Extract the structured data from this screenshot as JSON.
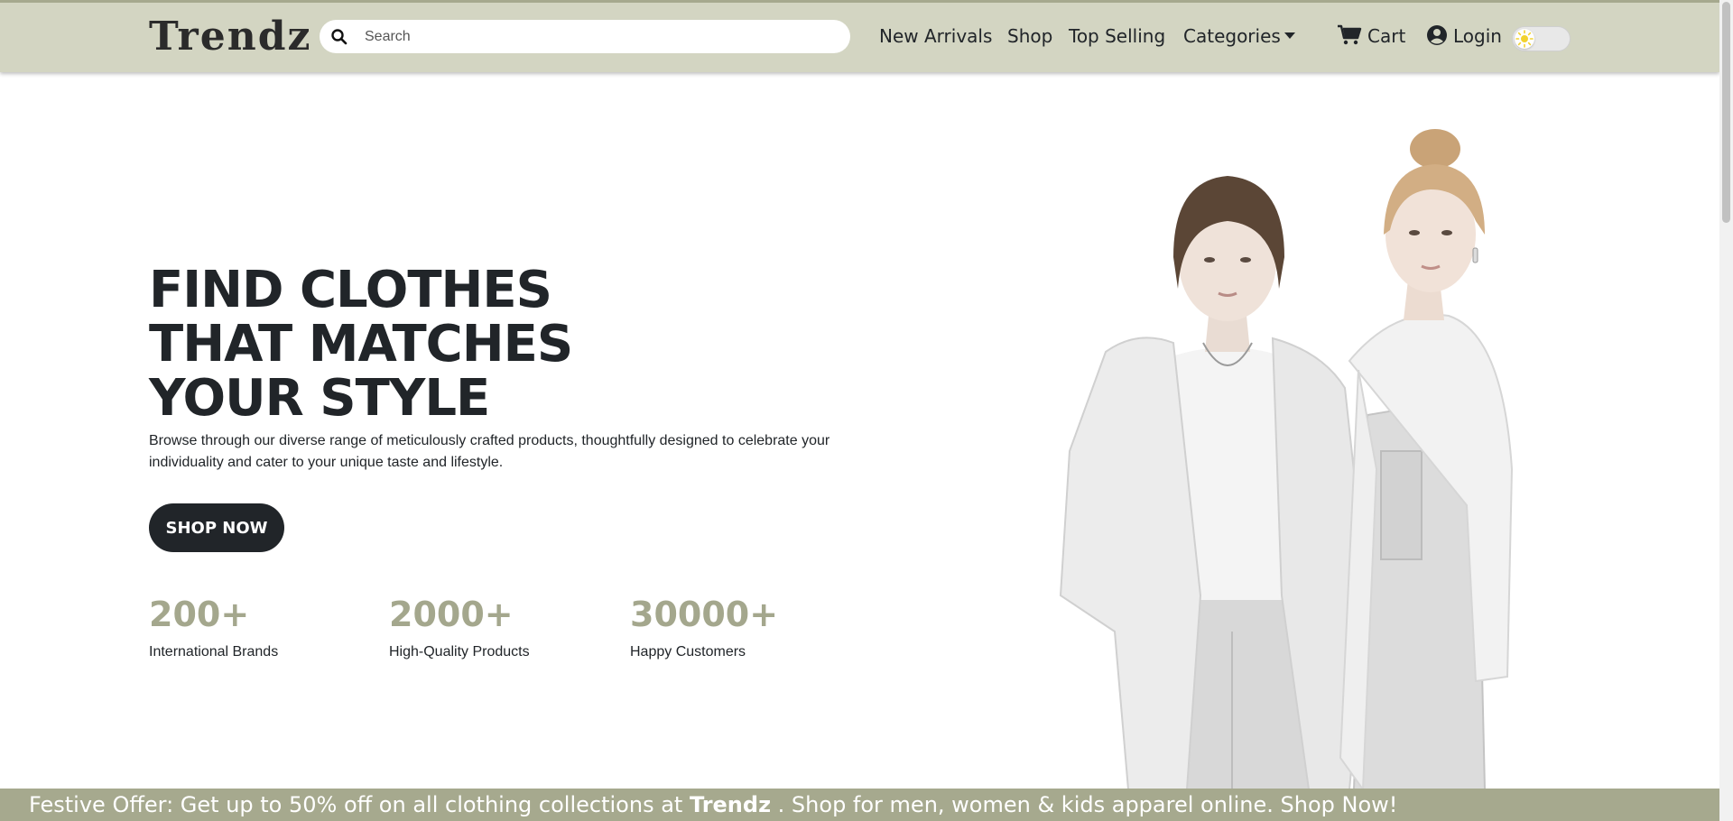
{
  "header": {
    "logo": "Trendz",
    "search_placeholder": "Search",
    "nav": {
      "new_arrivals": "New Arrivals",
      "shop": "Shop",
      "top_selling": "Top Selling",
      "categories": "Categories",
      "cart": "Cart",
      "login": "Login"
    },
    "theme_toggle": {
      "state": "light",
      "icon": "sun-icon"
    }
  },
  "hero": {
    "title_lines": [
      "FIND CLOTHES",
      "THAT MATCHES",
      "YOUR STYLE"
    ],
    "description": "Browse through our diverse range of meticulously crafted products, thoughtfully designed to celebrate your individuality and cater to your unique taste and lifestyle.",
    "cta": "SHOP NOW",
    "stats": [
      {
        "value": "200+",
        "label": "International Brands"
      },
      {
        "value": "2000+",
        "label": "High-Quality Products"
      },
      {
        "value": "30000+",
        "label": "Happy Customers"
      }
    ]
  },
  "banner": {
    "prefix": "Festive Offer: Get up to 50% off on all clothing collections at ",
    "brand": "Trendz",
    "suffix": " . Shop for men, women & kids apparel online. Shop Now!"
  },
  "colors": {
    "navbar_bg": "#d3d5c2",
    "accent": "#a4a78d",
    "banner_bg": "#a6a98e",
    "dark": "#212529"
  }
}
